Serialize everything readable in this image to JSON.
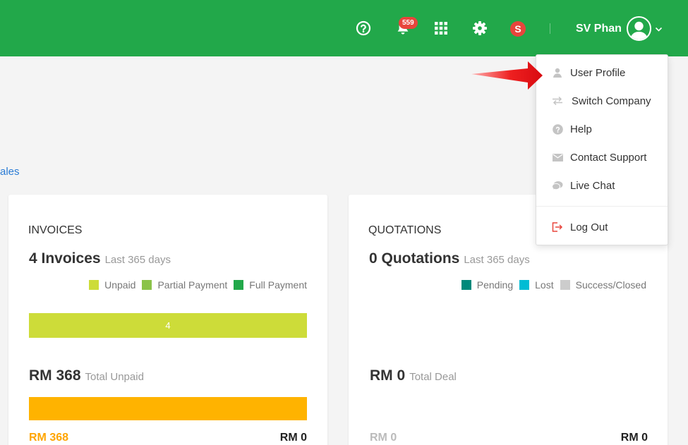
{
  "header": {
    "notification_count": "559",
    "company_logo_letter": "S",
    "user_name": "SV Phan"
  },
  "sales_link": "ales",
  "invoices": {
    "title": "INVOICES",
    "count": "4 Invoices",
    "period": "Last 365 days",
    "legend": [
      {
        "label": "Unpaid",
        "color": "#cddc39"
      },
      {
        "label": "Partial Payment",
        "color": "#8bc34a"
      },
      {
        "label": "Full Payment",
        "color": "#22a84a"
      }
    ],
    "bar_value": "4",
    "bar_color": "#cddc39",
    "total": "RM 368",
    "total_label": "Total Unpaid",
    "total_bar_color": "#ffb300",
    "foot_left": "RM 368",
    "foot_right": "RM 0"
  },
  "quotations": {
    "title": "QUOTATIONS",
    "count": "0 Quotations",
    "period": "Last 365 days",
    "legend": [
      {
        "label": "Pending",
        "color": "#00897b"
      },
      {
        "label": "Lost",
        "color": "#00bcd4"
      },
      {
        "label": "Success/Closed",
        "color": "#cccccc"
      }
    ],
    "total": "RM 0",
    "total_label": "Total Deal",
    "foot_left": "RM 0",
    "foot_right": "RM 0"
  },
  "menu": {
    "items": [
      {
        "label": "User Profile",
        "icon": "user-icon"
      },
      {
        "label": "Switch Company",
        "icon": "switch-arrows-icon"
      },
      {
        "label": "Help",
        "icon": "help-icon"
      },
      {
        "label": "Contact Support",
        "icon": "envelope-icon"
      },
      {
        "label": "Live Chat",
        "icon": "chat-icon"
      },
      {
        "label": "Log Out",
        "icon": "logout-icon"
      }
    ]
  },
  "colors": {
    "brand_green": "#22a84a",
    "badge_red": "#e8453c",
    "link_blue": "#2a7bd4",
    "logout_red": "#e8453c",
    "pointer_arrow": "#e8151b"
  }
}
